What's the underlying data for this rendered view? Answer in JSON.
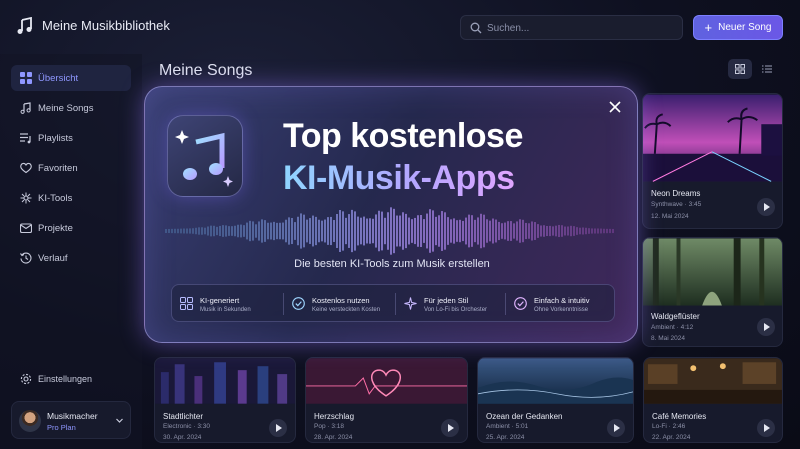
{
  "app": {
    "title": "Meine Musikbibliothek"
  },
  "search": {
    "placeholder": "Suchen..."
  },
  "header": {
    "new_song": "Neuer Song",
    "new_song_plus": "+"
  },
  "sidebar": {
    "items": [
      {
        "label": "Übersicht",
        "icon": "dashboard-grid-icon",
        "active": true
      },
      {
        "label": "Meine Songs",
        "icon": "music-note-icon"
      },
      {
        "label": "Playlists",
        "icon": "playlist-icon"
      },
      {
        "label": "Favoriten",
        "icon": "heart-icon"
      },
      {
        "label": "KI-Tools",
        "icon": "ai-tools-icon"
      },
      {
        "label": "Projekte",
        "icon": "folder-icon"
      },
      {
        "label": "Verlauf",
        "icon": "history-icon"
      }
    ],
    "settings": "Einstellungen",
    "user": {
      "name": "Musikmacher",
      "plan": "Pro Plan"
    }
  },
  "main": {
    "title": "Meine Songs",
    "songs_right": [
      {
        "title": "Neon Dreams",
        "meta": "Synthwave · 3:45",
        "date": "12. Mai 2024"
      },
      {
        "title": "Waldgeflüster",
        "meta": "Ambient · 4:12",
        "date": "8. Mai 2024"
      }
    ],
    "songs_bottom": [
      {
        "title": "Stadtlichter",
        "meta": "Electronic · 3:30",
        "date": "30. Apr. 2024"
      },
      {
        "title": "Herzschlag",
        "meta": "Pop · 3:18",
        "date": "28. Apr. 2024"
      },
      {
        "title": "Ozean der Gedanken",
        "meta": "Ambient · 5:01",
        "date": "25. Apr. 2024"
      },
      {
        "title": "Café Memories",
        "meta": "Lo-Fi · 2:46",
        "date": "22. Apr. 2024"
      }
    ]
  },
  "modal": {
    "title_line1": "Top kostenlose",
    "title_line2": "KI-Musik-Apps",
    "subtitle": "Die besten KI-Tools zum Musik erstellen",
    "features": [
      {
        "title": "KI-generiert",
        "sub": "Musik in Sekunden",
        "icon": "ai-grid-icon"
      },
      {
        "title": "Kostenlos nutzen",
        "sub": "Keine versteckten Kosten",
        "icon": "check-shield-icon"
      },
      {
        "title": "Für jeden Stil",
        "sub": "Von Lo-Fi bis Orchester",
        "icon": "sparkle-icon"
      },
      {
        "title": "Einfach & intuitiv",
        "sub": "Ohne Vorkenntnisse",
        "icon": "check-circle-icon"
      }
    ]
  },
  "colors": {
    "accent": "#6b6ff0",
    "background": "#0e1020",
    "card": "#171a2c"
  }
}
